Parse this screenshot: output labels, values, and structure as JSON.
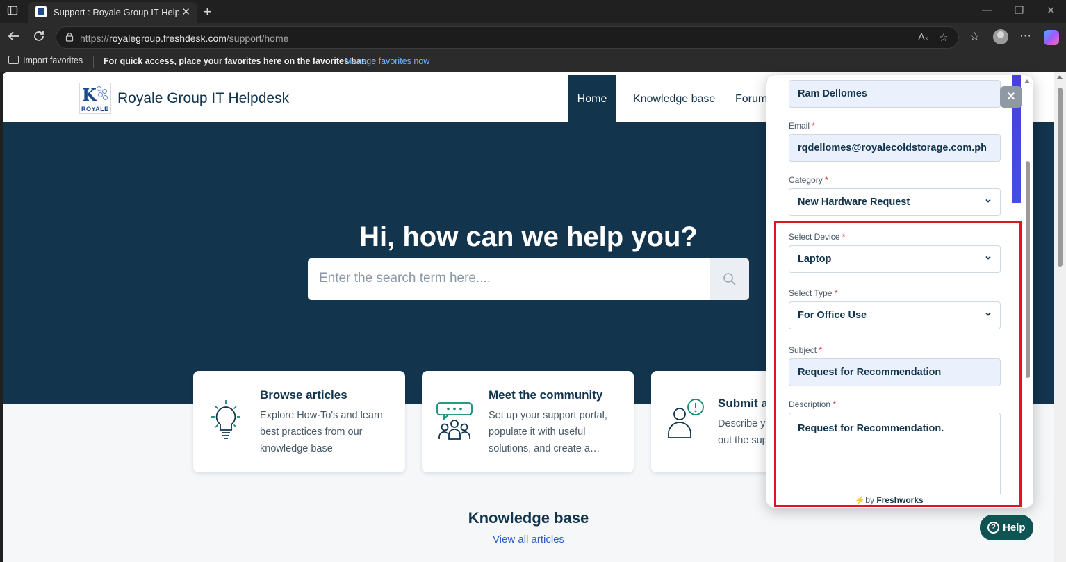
{
  "browser": {
    "tab_title": "Support : Royale Group IT Helpdesk",
    "url_prefix": "https://",
    "url_host": "royalegroup.freshdesk.com",
    "url_path": "/support/home",
    "favorites_import": "Import favorites",
    "favorites_message": "For quick access, place your favorites here on the favorites bar.",
    "favorites_link": "Manage favorites now"
  },
  "site": {
    "logo_word": "ROYALE",
    "title": "Royale Group IT Helpdesk",
    "nav": [
      {
        "label": "Home",
        "active": true
      },
      {
        "label": "Knowledge base",
        "active": false
      },
      {
        "label": "Forums",
        "active": false
      }
    ]
  },
  "hero": {
    "title": "Hi, how can we help you?",
    "search_placeholder": "Enter the search term here...."
  },
  "cards": [
    {
      "title": "Browse articles",
      "desc": "Explore How-To's and learn best practices from our knowledge base",
      "icon": "lightbulb-icon"
    },
    {
      "title": "Meet the community",
      "desc": "Set up your support portal, populate it with useful solutions, and create a…",
      "icon": "community-icon"
    },
    {
      "title": "Submit a ticket",
      "desc": "Describe your issue and fill out the support form",
      "icon": "submit-ticket-icon"
    }
  ],
  "knowledge_base": {
    "title": "Knowledge base",
    "link": "View all articles"
  },
  "widget": {
    "name_value": "Ram Dellomes",
    "email_label": "Email",
    "email_value": "rqdellomes@royalecoldstorage.com.ph",
    "category_label": "Category",
    "category_value": "New Hardware Request",
    "device_label": "Select Device",
    "device_value": "Laptop",
    "type_label": "Select Type",
    "type_value": "For Office Use",
    "subject_label": "Subject",
    "subject_value": "Request for Recommendation",
    "description_label": "Description",
    "description_value": "Request for Recommendation.",
    "powered_prefix": "by",
    "powered_brand": "Freshworks",
    "required_mark": "*",
    "close_symbol": "×"
  },
  "help_button": {
    "label": "Help"
  },
  "colors": {
    "brand_navy": "#12344d",
    "widget_accent": "#4c39d8",
    "highlight": "#e0141e",
    "help_teal": "#0f5353"
  }
}
